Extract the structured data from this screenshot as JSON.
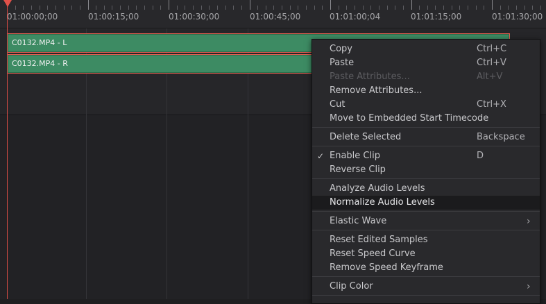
{
  "ruler": {
    "labels": [
      "01:00:00;00",
      "01:00:15;00",
      "01:00:30;00",
      "01:00:45;00",
      "01:01:00;04",
      "01:01:15;00",
      "01:01:30;00"
    ]
  },
  "clips": [
    {
      "name": "C0132.MP4 - L"
    },
    {
      "name": "C0132.MP4 - R"
    }
  ],
  "menu": {
    "items": [
      {
        "label": "Copy",
        "shortcut": "Ctrl+C",
        "enabled": true
      },
      {
        "label": "Paste",
        "shortcut": "Ctrl+V",
        "enabled": true
      },
      {
        "label": "Paste Attributes...",
        "shortcut": "Alt+V",
        "enabled": false
      },
      {
        "label": "Remove Attributes...",
        "shortcut": "",
        "enabled": true
      },
      {
        "label": "Cut",
        "shortcut": "Ctrl+X",
        "enabled": true
      },
      {
        "label": "Move to Embedded Start Timecode",
        "shortcut": "",
        "enabled": true
      },
      {
        "label": "Delete Selected",
        "shortcut": "Backspace",
        "enabled": true
      },
      {
        "label": "Enable Clip",
        "shortcut": "D",
        "enabled": true,
        "checked": true
      },
      {
        "label": "Reverse Clip",
        "shortcut": "",
        "enabled": true
      },
      {
        "label": "Analyze Audio Levels",
        "shortcut": "",
        "enabled": true
      },
      {
        "label": "Normalize Audio Levels",
        "shortcut": "",
        "enabled": true,
        "highlighted": true
      },
      {
        "label": "Elastic Wave",
        "shortcut": "",
        "enabled": true,
        "submenu": true
      },
      {
        "label": "Reset Edited Samples",
        "shortcut": "",
        "enabled": true
      },
      {
        "label": "Reset Speed Curve",
        "shortcut": "",
        "enabled": true
      },
      {
        "label": "Remove Speed Keyframe",
        "shortcut": "",
        "enabled": true
      },
      {
        "label": "Clip Color",
        "shortcut": "",
        "enabled": true,
        "submenu": true
      }
    ],
    "check_glyph": "✓",
    "submenu_glyph": "›"
  },
  "colors": {
    "clip_fill": "#3d8b63",
    "clip_selected_border": "#e35e4f",
    "playhead": "#d04a44"
  }
}
